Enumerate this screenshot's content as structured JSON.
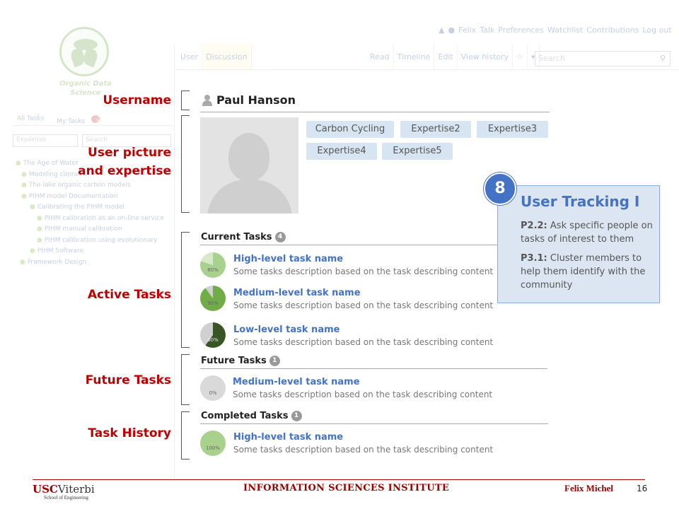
{
  "background_ui": {
    "logo_text": "Organic Data Science",
    "top_links": [
      "Felix",
      "Talk",
      "Preferences",
      "Watchlist",
      "Contributions",
      "Log out"
    ],
    "left_tabs": [
      "User",
      "Discussion"
    ],
    "right_tabs": [
      "Read",
      "Timeline",
      "Edit",
      "View history",
      "☆",
      "▾"
    ],
    "search_placeholder": "Search",
    "sidebar": {
      "tabs": [
        "All Tasks",
        "My Tasks"
      ],
      "my_tasks_count": "3",
      "filter_placeholder": "Expertise",
      "search_placeholder": "Search",
      "tree": [
        "The Age of Water",
        "Modeling connec...",
        "The lake organic carbon models",
        "PIHM model Documentation",
        "Calibrating the PIHM model",
        "PIHM calibration as an on-line service",
        "PIHM manual calibration",
        "PIHM calibration using evolutionary",
        "PIHM Software",
        "Framework Design"
      ]
    }
  },
  "annotations": {
    "username": "Username",
    "picture_line1": "User picture",
    "picture_line2": "and expertise",
    "active": "Active Tasks",
    "future": "Future Tasks",
    "history": "Task History"
  },
  "user": {
    "name": "Paul Hanson",
    "expertise": [
      "Carbon Cycling",
      "Expertise2",
      "Expertise3",
      "Expertise4",
      "Expertise5"
    ]
  },
  "sections": {
    "current": {
      "title": "Current Tasks",
      "count": "4",
      "tasks": [
        {
          "name": "High-level task name",
          "desc": "Some tasks description based on the task describing content",
          "progress": 80,
          "progress_label": "80%",
          "color": "#a9d18e",
          "bg": "#d6eac6"
        },
        {
          "name": "Medium-level task name",
          "desc": "Some tasks description based on the task describing content",
          "progress": 90,
          "progress_label": "90%",
          "color": "#70ad47",
          "bg": "#d0d0d0"
        },
        {
          "name": "Low-level task name",
          "desc": "Some tasks description based on the task describing content",
          "progress": 60,
          "progress_label": "60%",
          "color": "#375623",
          "bg": "#d0d0d0"
        }
      ]
    },
    "future": {
      "title": "Future Tasks",
      "count": "1",
      "tasks": [
        {
          "name": "Medium-level task name",
          "desc": "Some tasks description based on the task describing content",
          "progress": 0,
          "progress_label": "0%",
          "color": "#d9d9d9",
          "bg": "#d9d9d9"
        }
      ]
    },
    "completed": {
      "title": "Completed Tasks",
      "count": "1",
      "tasks": [
        {
          "name": "High-level task name",
          "desc": "Some tasks description based on the task describing content",
          "progress": 100,
          "progress_label": "100%",
          "color": "#a9d18e",
          "bg": "#a9d18e"
        }
      ]
    }
  },
  "callout": {
    "number": "8",
    "title": "User Tracking I",
    "p1_ref": "P2.2:",
    "p1_text": " Ask specific people on tasks of interest to them",
    "p2_ref": "P3.1:",
    "p2_text": " Cluster members to help them identify with the community"
  },
  "footer": {
    "usc": "USC",
    "viterbi": "Viterbi",
    "school": "School of Engineering",
    "institute": "INFORMATION SCIENCES INSTITUTE",
    "author": "Felix Michel",
    "page": "16"
  }
}
